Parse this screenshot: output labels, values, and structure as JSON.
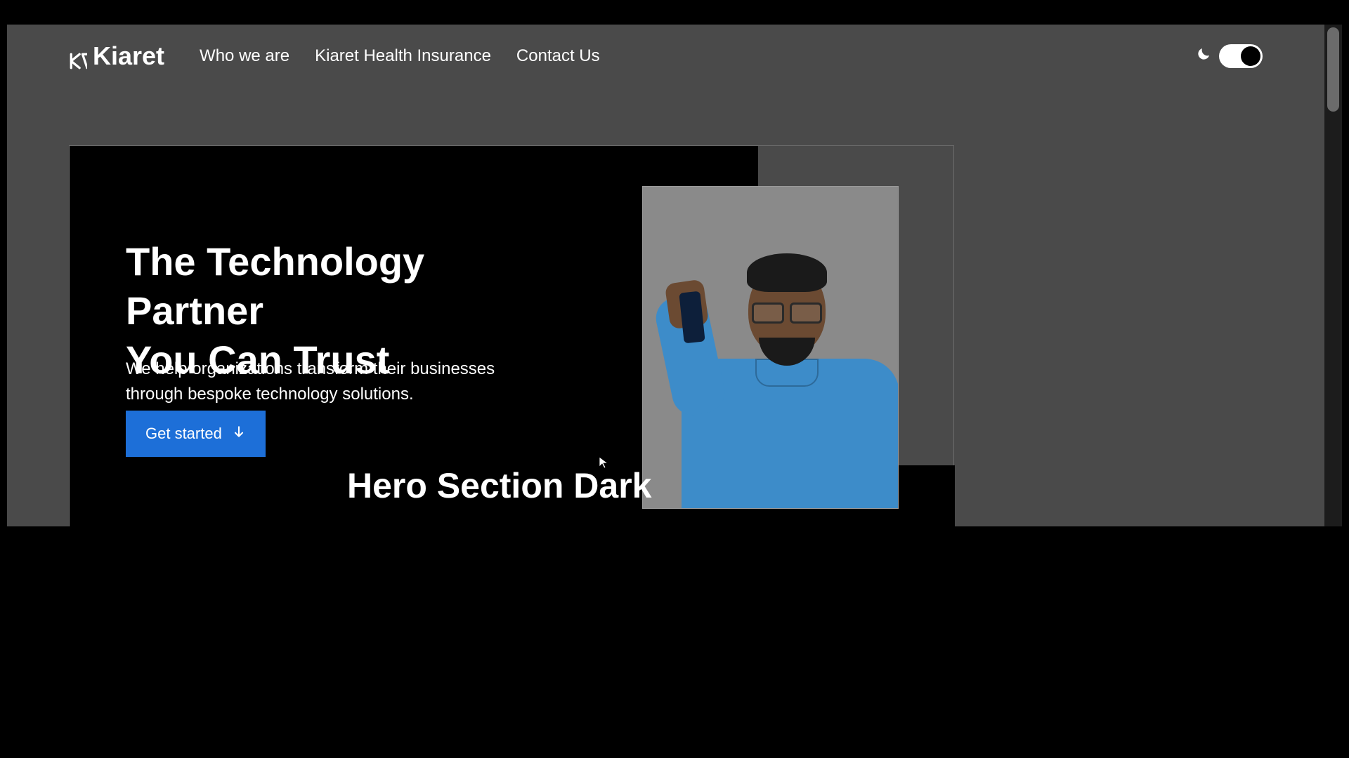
{
  "brand": {
    "name": "Kiaret"
  },
  "nav": {
    "items": [
      {
        "label": "Who we are"
      },
      {
        "label": "Kiaret Health Insurance"
      },
      {
        "label": "Contact Us"
      }
    ]
  },
  "theme": {
    "mode": "dark",
    "toggle_on": true
  },
  "hero": {
    "title_line1": "The Technology Partner",
    "title_line2": "You Can Trust",
    "subtitle": "We help organizations transform their businesses through bespoke technology solutions.",
    "cta_label": "Get started"
  },
  "overlay": {
    "section_label": "Hero Section Dark"
  },
  "colors": {
    "accent": "#1d6fd8",
    "page_bg": "#4a4a4a",
    "panel": "#000000"
  }
}
